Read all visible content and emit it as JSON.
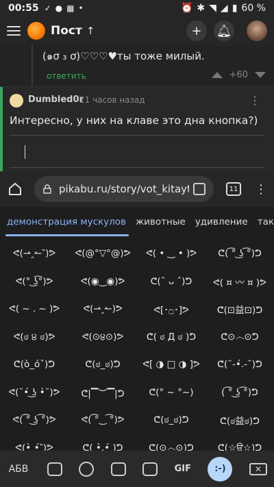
{
  "status": {
    "time": "00:55",
    "battery": "60 %"
  },
  "header": {
    "title": "Пост",
    "up": "↑"
  },
  "comment1": {
    "text": "(๑ơ ₃ ơ)♡♡♡♥ты тоже милый.",
    "reply": "ответить",
    "score": "+60"
  },
  "comment2": {
    "author": "Dumbled0r",
    "time": "11 часов назад",
    "text": "Интересно, у них на клаве это дна кнопка?)"
  },
  "browser": {
    "url": "pikabu.ru/story/vot_kitayt",
    "tab_count": "11"
  },
  "keyboard": {
    "categories": [
      "демонстрация мускулов",
      "животные",
      "удивление",
      "так"
    ],
    "kaomoji": [
      "ᕙ(⇀‸↼‶)ᕗ",
      "ᕙ(@°▽°@)ᕗ",
      "ᕙ( • ‿ • )ᕗ",
      "ᕦ( ͡° ͜ʖ ͡°)ᕤ",
      "ᕙ(° ͜ʖ͡°)ᕗ",
      "ᕙ(◉‿◉)ᕗ",
      "ᕦ(ˆ ᴗ ˆ)ᕤ",
      "ᕙ( ¤ 〰 ¤ )ᕗ",
      "ᕙ( ~ . ~ )ᕗ",
      "ᕙ(⇀‸↼)ᕗ",
      "ᕙ[･۝･]ᕗ",
      "ᕦ(⊡益⊡)ᕤ",
      "ᕙ(ಠ ੪ ಠ)ᕗ",
      "ᕙ(⊙੪⊙)ᕗ",
      "ᕦ( ಠ Д ಠ )ᕤ",
      "ᕦ⊙෴⊙ᕤ",
      "ᕦ(ò_óˇ)ᕤ",
      "ᕦ(ಠ_ಠ)ᕤ",
      "ᕙ[ ◑ □ ◑ ]ᕗ",
      "ᕦ(˘-•́.-˘)ᕤ",
      "ᕙ(˘•́ ͜ʖ •̀˘)ᕗ",
      "ᕦ|▔︶▔|ᕤ",
      "ᕦ(° ~ °~)",
      "( ͡° ͜ʖ ͡°)ᕤ",
      "ᕙ( ͡° ͜ʖ ͡°)ᕗ",
      "ᕙ( ͡°‿ ͡°)ᕗ",
      "ᕦ(ಠ_ಠ)ᕤ",
      "ᕦ(ಠ益ಠ)ᕤ",
      "ᕙ(•̀‸•́‶)ᕗ",
      "ᕦ( •̀.̫•́ )ᕤ",
      "ᕦ(⊙෴⊙)ᕤ",
      "ᕦ(☆ਊ☆)ᕤ"
    ],
    "toolbar": {
      "abc": "АБВ",
      "gif": "GIF",
      "kaomoji": ":-)"
    }
  },
  "colors": {
    "accent": "#39a85e",
    "selected": "#8ab4f8"
  }
}
